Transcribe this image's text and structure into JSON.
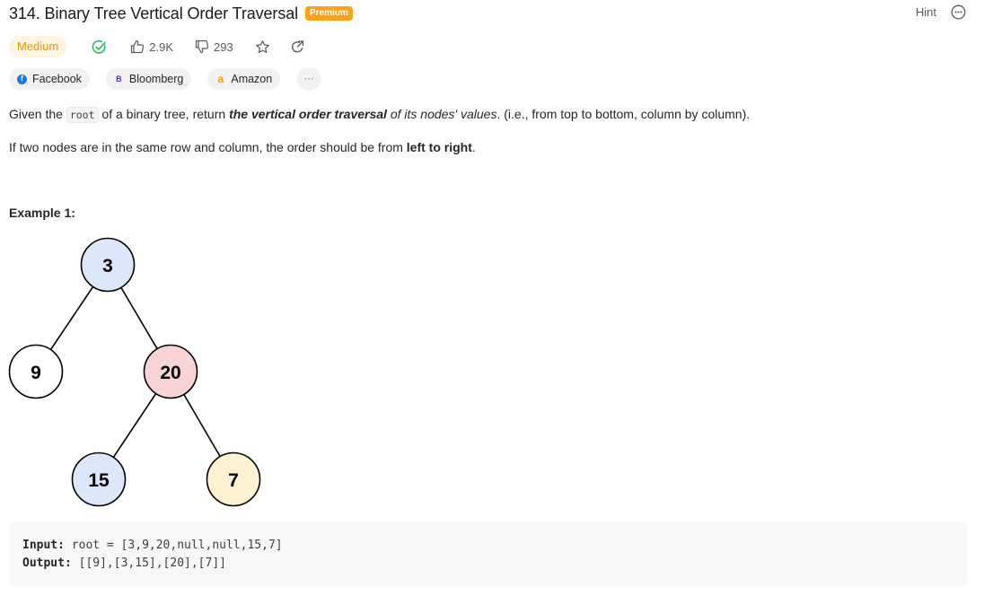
{
  "problem": {
    "title": "314. Binary Tree Vertical Order Traversal",
    "premium_badge": "Premium"
  },
  "header_actions": {
    "hint_label": "Hint"
  },
  "meta": {
    "difficulty": "Medium",
    "likes": "2.9K",
    "dislikes": "293"
  },
  "companies": [
    {
      "name": "Facebook",
      "logo": "f"
    },
    {
      "name": "Bloomberg",
      "logo": "B"
    },
    {
      "name": "Amazon",
      "logo": "a"
    }
  ],
  "companies_more": "···",
  "description": {
    "p1_a": "Given the ",
    "p1_code": "root",
    "p1_b": " of a binary tree, return ",
    "p1_bold_italic": "the vertical order traversal",
    "p1_italic": " of its nodes' values",
    "p1_c": ". (i.e., from top to bottom, column by column).",
    "p2_a": "If two nodes are in the same row and column, the order should be from ",
    "p2_bold": "left to right",
    "p2_b": "."
  },
  "example": {
    "title": "Example 1:",
    "tree_nodes": [
      {
        "value": "3",
        "color": "#dce8fa"
      },
      {
        "value": "9",
        "color": "#ffffff"
      },
      {
        "value": "20",
        "color": "#f8d3d3"
      },
      {
        "value": "15",
        "color": "#dce8fa"
      },
      {
        "value": "7",
        "color": "#fdf3d3"
      }
    ],
    "input_label": "Input:",
    "input_value": "root = [3,9,20,null,null,15,7]",
    "output_label": "Output:",
    "output_value": "[[9],[3,15],[20],[7]]"
  },
  "colors": {
    "premium": "#ffa116",
    "difficulty_medium": "#e59b00",
    "solved_check": "#2cbb5d"
  }
}
